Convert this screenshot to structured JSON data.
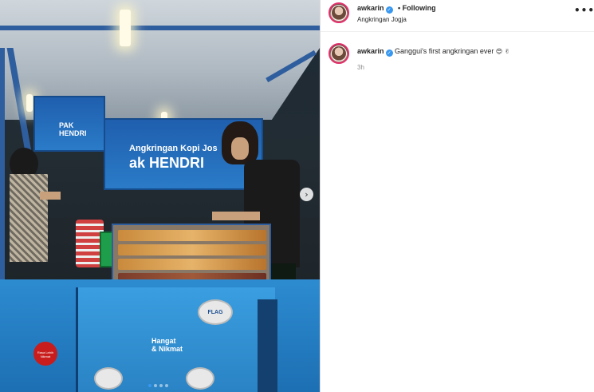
{
  "post": {
    "username": "awkarin",
    "verified_icon": "verified-badge-icon",
    "separator": "•",
    "follow_status": "Following",
    "location": "Angkringan Jogja",
    "more_icon": "more-options-icon",
    "more_label": "•••"
  },
  "caption": {
    "username": "awkarin",
    "text": "Ganggui's first angkringan ever",
    "emojis": "😍 ✌"
  },
  "timestamp": "3h",
  "media": {
    "banner_1": "PAK HENDRI",
    "banner_2": "Angkringan Kopi Jos",
    "banner_3": "ak HENDRI",
    "counter_text_1": "Hangat",
    "counter_text_2": "& Nikmat",
    "brand": "FLAG",
    "side_text": "Rasa Lebih Nikmat",
    "carousel_count": 4,
    "carousel_active": 0
  },
  "colors": {
    "accent": "#3897f0",
    "story_ring": "#e1306c",
    "text": "#262626",
    "muted": "#8e8e8e"
  }
}
